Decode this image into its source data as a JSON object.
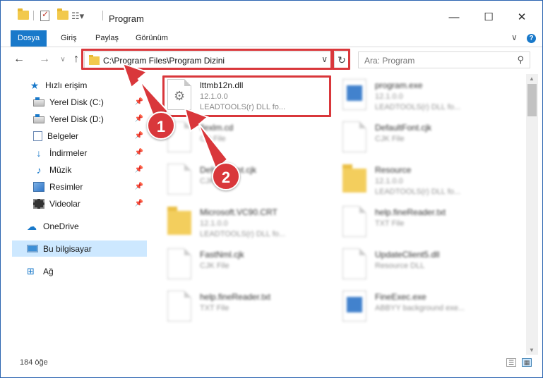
{
  "window": {
    "title": "Program",
    "minimize_icon": "minimize-icon",
    "maximize_icon": "maximize-icon",
    "close_icon": "close-icon"
  },
  "ribbon": {
    "tabs": [
      {
        "label": "Dosya",
        "active": true
      },
      {
        "label": "Giriş",
        "active": false
      },
      {
        "label": "Paylaş",
        "active": false
      },
      {
        "label": "Görünüm",
        "active": false
      }
    ],
    "expand_glyph": "∨",
    "help_glyph": "?"
  },
  "navigation": {
    "back": "←",
    "forward": "→",
    "recent": "∨",
    "up": "↑",
    "address": "C:\\Program Files\\Program Dizini",
    "address_chevron": "∨",
    "refresh": "↻",
    "search_placeholder": "Ara: Program",
    "search_glyph": "⚲"
  },
  "sidebar": {
    "items": [
      {
        "label": "Hızlı erişim",
        "icon": "star-icon",
        "pinned": false
      },
      {
        "label": "Yerel Disk (C:)",
        "icon": "disk-icon",
        "pinned": true
      },
      {
        "label": "Yerel Disk (D:)",
        "icon": "disk-icon",
        "pinned": true
      },
      {
        "label": "Belgeler",
        "icon": "documents-icon",
        "pinned": true
      },
      {
        "label": "İndirmeler",
        "icon": "downloads-icon",
        "pinned": true
      },
      {
        "label": "Müzik",
        "icon": "music-icon",
        "pinned": true
      },
      {
        "label": "Resimler",
        "icon": "pictures-icon",
        "pinned": true
      },
      {
        "label": "Videolar",
        "icon": "videos-icon",
        "pinned": true
      },
      {
        "label": "OneDrive",
        "icon": "cloud-icon",
        "pinned": false
      },
      {
        "label": "Bu bilgisayar",
        "icon": "computer-icon",
        "pinned": false,
        "selected": true
      },
      {
        "label": "Ağ",
        "icon": "network-icon",
        "pinned": false
      }
    ],
    "pin_glyph": "📌"
  },
  "files": [
    {
      "name": "lttmb12n.dll",
      "line1": "12.1.0.0",
      "line2": "LEADTOOLS(r) DLL fo...",
      "icon": "dll-file-icon",
      "highlighted": true
    },
    {
      "name": "program.exe",
      "line1": "12.1.0.0",
      "line2": "LEADTOOLS(r) DLL fo...",
      "icon": "exe-file-icon"
    },
    {
      "name": "flexlm.cd",
      "line1": "CD File",
      "line2": "",
      "icon": "file-icon"
    },
    {
      "name": "DefaultFont.cjk",
      "line1": "CJK File",
      "line2": "",
      "icon": "file-icon"
    },
    {
      "name": "DefaultFont.cjk",
      "line1": "CJK File",
      "line2": "",
      "icon": "file-icon"
    },
    {
      "name": "Resource",
      "line1": "12.1.0.0",
      "line2": "LEADTOOLS(r) DLL fo...",
      "icon": "folder-icon"
    },
    {
      "name": "Microsoft.VC90.CRT",
      "line1": "12.1.0.0",
      "line2": "LEADTOOLS(r) DLL fo...",
      "icon": "folder-icon"
    },
    {
      "name": "help.fineReader.txt",
      "line1": "TXT File",
      "line2": "",
      "icon": "file-icon"
    },
    {
      "name": "FastNml.cjk",
      "line1": "CJK File",
      "line2": "",
      "icon": "file-icon"
    },
    {
      "name": "UpdateClient5.dll",
      "line1": "Resource DLL",
      "line2": "",
      "icon": "file-icon"
    },
    {
      "name": "help.fineReader.txt",
      "line1": "TXT File",
      "line2": "",
      "icon": "file-icon"
    },
    {
      "name": "FineExec.exe",
      "line1": "ABBYY background exe...",
      "line2": "",
      "icon": "exe-file-icon"
    }
  ],
  "status": {
    "count": "184 öğe"
  },
  "annotations": {
    "badge1": "1",
    "badge2": "2",
    "color": "#d9373b"
  }
}
